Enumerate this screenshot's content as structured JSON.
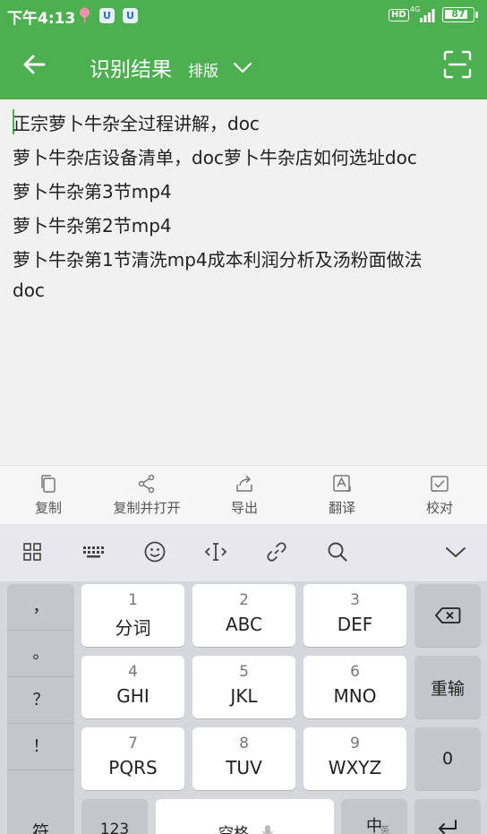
{
  "status_bar": {
    "time": "下午4:13",
    "u_badge_1": "U",
    "u_badge_2": "U",
    "hd": "HD",
    "network": "4G",
    "battery": "87",
    "battery_level": 0.87
  },
  "app_bar": {
    "title": "识别结果",
    "layout_mode": "排版"
  },
  "result": {
    "lines": [
      "正宗萝卜牛杂全过程讲解，doc",
      "萝卜牛杂店设备清单，doc萝卜牛杂店如何选址doc",
      "萝卜牛杂第3节mp4",
      "萝卜牛杂第2节mp4",
      "萝卜牛杂第1节清洗mp4成本利润分析及汤粉面做法",
      "doc"
    ]
  },
  "actions": [
    {
      "label": "复制",
      "icon": "copy-icon"
    },
    {
      "label": "复制并打开",
      "icon": "share-icon"
    },
    {
      "label": "导出",
      "icon": "export-icon"
    },
    {
      "label": "翻译",
      "icon": "translate-icon"
    },
    {
      "label": "校对",
      "icon": "proofread-icon"
    }
  ],
  "keyboard": {
    "punctuation": [
      "，",
      "。",
      "？",
      "！"
    ],
    "keys": [
      {
        "num": "1",
        "letters": "分词"
      },
      {
        "num": "2",
        "letters": "ABC"
      },
      {
        "num": "3",
        "letters": "DEF"
      },
      {
        "num": "4",
        "letters": "GHI"
      },
      {
        "num": "5",
        "letters": "JKL"
      },
      {
        "num": "6",
        "letters": "MNO"
      },
      {
        "num": "7",
        "letters": "PQRS"
      },
      {
        "num": "8",
        "letters": "TUV"
      },
      {
        "num": "9",
        "letters": "WXYZ"
      }
    ],
    "reenter": "重输",
    "zero": "0",
    "symbol": "符",
    "num_switch": "123",
    "space": "空格",
    "lang": "中",
    "lang_sub": "英"
  },
  "colors": {
    "accent": "#4caf50"
  }
}
